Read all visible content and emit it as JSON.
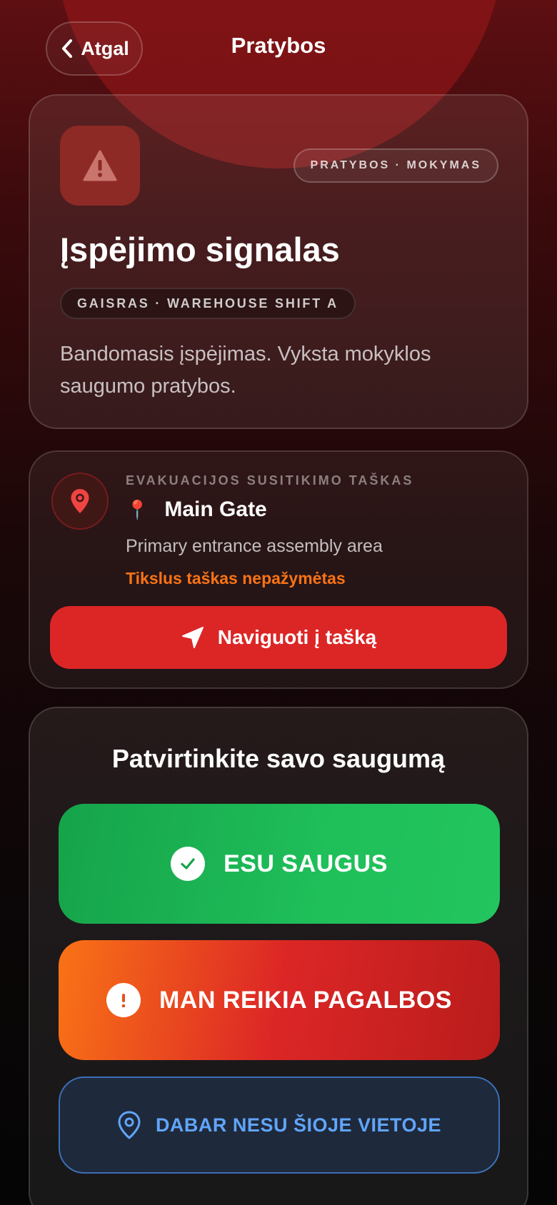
{
  "header": {
    "back_label": "Atgal",
    "title": "Pratybos"
  },
  "alert": {
    "mode_badge": "PRATYBOS · MOKYMAS",
    "title": "Įspėjimo signalas",
    "type_badge": "GAISRAS · WAREHOUSE SHIFT A",
    "description": "Bandomasis įspėjimas. Vyksta mokyklos saugumo pratybos.",
    "icon": "warning-triangle-icon"
  },
  "assembly_point": {
    "label": "EVAKUACIJOS SUSITIKIMO TAŠKAS",
    "pin_emoji": "📍",
    "name": "Main Gate",
    "description": "Primary entrance assembly area",
    "warning": "Tikslus taškas nepažymėtas",
    "navigate_label": "Naviguoti į tašką",
    "icon": "map-pin-icon"
  },
  "safety": {
    "title": "Patvirtinkite savo saugumą",
    "safe_label": "ESU SAUGUS",
    "help_label": "MAN REIKIA PAGALBOS",
    "away_label": "DABAR NESU ŠIOJE VIETOJE"
  },
  "colors": {
    "danger": "#dc2626",
    "safe": "#22c55e",
    "warning": "#f97316",
    "info": "#60a5fa"
  }
}
